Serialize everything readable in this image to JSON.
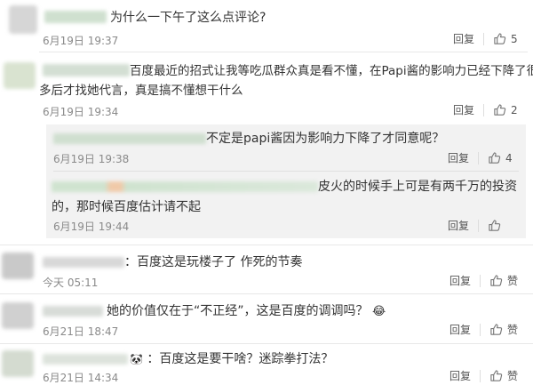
{
  "comments": [
    {
      "text": "为什么一下午了这么点评论?",
      "time": "6月19日 19:37",
      "reply": "回复",
      "likes": "5"
    },
    {
      "text_line1": "百度最近的招式让我等吃瓜群众真是看不懂，在Papi酱的影响力已经下降了很",
      "text_line2": "多后才找她代言，真是搞不懂想干什么",
      "time": "6月19日 19:34",
      "reply": "回复",
      "likes": "2"
    },
    {
      "text": "不定是papi酱因为影响力下降了才同意呢？",
      "time": "6月19日 19:38",
      "reply": "回复",
      "likes": "4"
    },
    {
      "text_line1": "皮火的时候手上可是有两千万的投资",
      "text_line2": "的，那时候百度估计请不起",
      "time": "6月19日 19:44",
      "reply": "回复",
      "likes": ""
    },
    {
      "text": "：百度这是玩楼子了 作死的节奏",
      "time": "今天 05:11",
      "reply": "回复",
      "likes": "赞"
    },
    {
      "text": "她的价值仅在于“不正经”，这是百度的调调吗？",
      "emoji": "😂",
      "time": "6月21日 18:47",
      "reply": "回复",
      "likes": "赞"
    },
    {
      "text": "：百度这是要干啥？迷踪拳打法？",
      "emoji": "🐼",
      "time": "6月21日 14:34",
      "reply": "回复",
      "likes": "赞"
    }
  ],
  "icons": {
    "like": "thumbs-up-icon",
    "reply_divider": "vertical-separator"
  }
}
